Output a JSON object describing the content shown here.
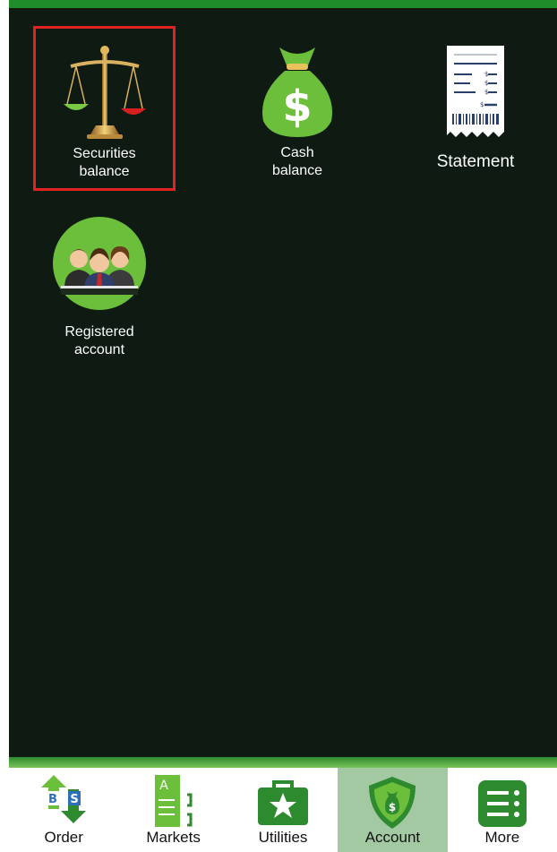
{
  "tiles": [
    {
      "label": "Securities\nbalance",
      "icon": "scales-icon",
      "selected": true
    },
    {
      "label": "Cash\nbalance",
      "icon": "money-bag-icon",
      "selected": false
    },
    {
      "label": "Statement",
      "icon": "statement-receipt-icon",
      "selected": false
    },
    {
      "label": "Registered\naccount",
      "icon": "people-group-icon",
      "selected": false
    }
  ],
  "receipt_marks": [
    "$",
    "$",
    "$",
    "$"
  ],
  "tabs": [
    {
      "label": "Order",
      "icon": "buy-sell-arrows-icon",
      "active": false
    },
    {
      "label": "Markets",
      "icon": "market-board-icon",
      "active": false
    },
    {
      "label": "Utilities",
      "icon": "briefcase-star-icon",
      "active": false
    },
    {
      "label": "Account",
      "icon": "shield-money-icon",
      "active": true
    },
    {
      "label": "More",
      "icon": "more-menu-icon",
      "active": false
    }
  ],
  "order_icon_text": {
    "b": "B",
    "s": "S"
  },
  "markets_icon_text": "A",
  "colors": {
    "background": "#0e1a12",
    "accent": "#1f8e2a",
    "icon_green": "#6cbf3b",
    "selection": "#e12222",
    "active_tab": "#a3c9a3"
  }
}
